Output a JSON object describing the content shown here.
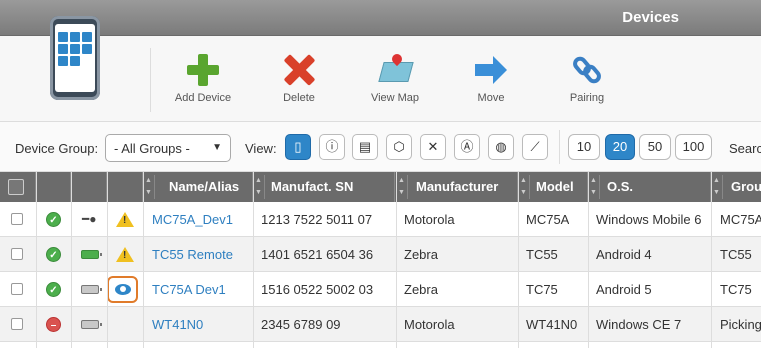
{
  "window": {
    "title": "Devices"
  },
  "toolbar": {
    "buttons": [
      {
        "label": "Add Device",
        "icon": "add-icon"
      },
      {
        "label": "Delete",
        "icon": "delete-icon"
      },
      {
        "label": "View Map",
        "icon": "map-icon"
      },
      {
        "label": "Move",
        "icon": "move-arrow-icon"
      },
      {
        "label": "Pairing",
        "icon": "pairing-link-icon"
      }
    ]
  },
  "filters": {
    "device_group_label": "Device Group:",
    "device_group_value": "- All Groups -",
    "view_label": "View:",
    "view_icons": [
      "device-view-icon",
      "info-icon",
      "document-icon",
      "package-icon",
      "tools-icon",
      "antenna-icon",
      "gps-icon",
      "ruler-icon"
    ],
    "page_sizes": [
      "10",
      "20",
      "50",
      "100"
    ],
    "selected_page_size": "20",
    "search_label": "Searc"
  },
  "table": {
    "columns": [
      "Name/Alias",
      "Manufact. SN",
      "Manufacturer",
      "Model",
      "O.S.",
      "Grou"
    ],
    "rows": [
      {
        "status": "ok",
        "power": "plug",
        "alert": "warning",
        "name": "MC75A_Dev1",
        "sn": "1213 7522 5011 07",
        "manufacturer": "Motorola",
        "model": "MC75A",
        "os": "Windows Mobile 6",
        "group": "MC75A"
      },
      {
        "status": "ok",
        "power": "battery-green",
        "alert": "warning",
        "name": "TC55 Remote",
        "sn": "1401 6521 6504 36",
        "manufacturer": "Zebra",
        "model": "TC55",
        "os": "Android 4",
        "group": "TC55"
      },
      {
        "status": "ok",
        "power": "battery-gray",
        "alert": "eye",
        "name": "TC75A Dev1",
        "sn": "1516 0522 5002 03",
        "manufacturer": "Zebra",
        "model": "TC75",
        "os": "Android 5",
        "group": "TC75"
      },
      {
        "status": "error",
        "power": "battery-gray",
        "alert": "none",
        "name": "WT41N0",
        "sn": "2345 6789 09",
        "manufacturer": "Motorola",
        "model": "WT41N0",
        "os": "Windows CE 7",
        "group": "Picking"
      }
    ]
  },
  "colors": {
    "accent": "#2e86c8",
    "link": "#2e7fc0",
    "header": "#6b6b6b",
    "highlight": "#e07b2a"
  }
}
